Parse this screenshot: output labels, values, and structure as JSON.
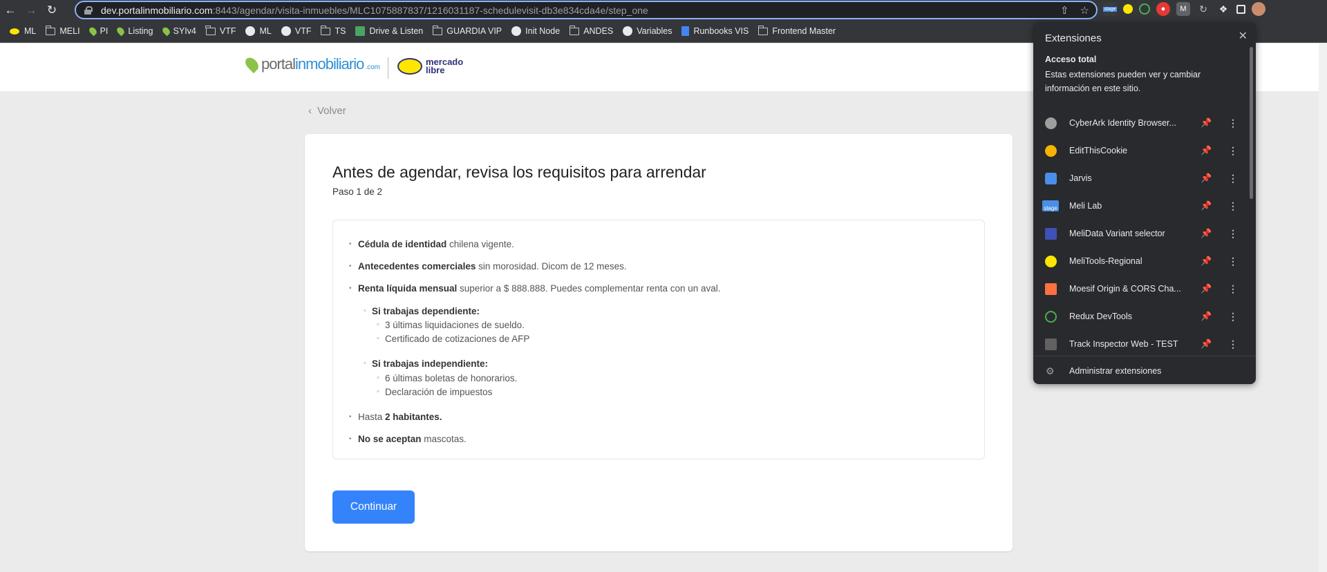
{
  "browser": {
    "url_host": "dev.portalinmobiliario.com",
    "url_path": ":8443/agendar/visita-inmuebles/MLC1075887837/1216031187-schedulevisit-db3e834cda4e/step_one",
    "bookmarks": [
      {
        "label": "ML",
        "icon": "meli-icon"
      },
      {
        "label": "MELI",
        "icon": "folder-icon"
      },
      {
        "label": "PI",
        "icon": "pin-icon"
      },
      {
        "label": "Listing",
        "icon": "pin-icon"
      },
      {
        "label": "SYIv4",
        "icon": "pin-icon"
      },
      {
        "label": "VTF",
        "icon": "folder-icon"
      },
      {
        "label": "ML",
        "icon": "github-icon"
      },
      {
        "label": "VTF",
        "icon": "cookie-icon"
      },
      {
        "label": "TS",
        "icon": "folder-icon"
      },
      {
        "label": "Drive & Listen",
        "icon": "drive-icon"
      },
      {
        "label": "GUARDIA VIP",
        "icon": "folder-icon"
      },
      {
        "label": "Init Node",
        "icon": "github-icon"
      },
      {
        "label": "ANDES",
        "icon": "folder-icon"
      },
      {
        "label": "Variables",
        "icon": "github-icon"
      },
      {
        "label": "Runbooks VIS",
        "icon": "doc-icon"
      },
      {
        "label": "Frontend Master",
        "icon": "folder-icon"
      }
    ]
  },
  "page": {
    "back": "Volver",
    "title": "Antes de agendar, revisa los requisitos para arrendar",
    "step": "Paso 1 de 2",
    "requirements": [
      {
        "strong": "Cédula de identidad",
        "text": " chilena vigente."
      },
      {
        "strong": "Antecedentes comerciales",
        "text": " sin morosidad. Dicom de 12 meses."
      },
      {
        "strong": "Renta líquida mensual",
        "text": " superior a $ 888.888. Puedes complementar renta con un aval."
      }
    ],
    "dependent": {
      "heading": "Si trabajas dependiente:",
      "items": [
        "3 últimas liquidaciones de sueldo.",
        "Certificado de cotizaciones de AFP"
      ]
    },
    "independent": {
      "heading": "Si trabajas independiente:",
      "items": [
        "6 últimas boletas de honorarios.",
        "Declaración de impuestos"
      ]
    },
    "inhabitants": {
      "text": "Hasta ",
      "strong": "2 habitantes."
    },
    "pets": {
      "strong": "No se aceptan",
      "text": " mascotas."
    },
    "continue": "Continuar"
  },
  "extensions": {
    "title": "Extensiones",
    "section": "Acceso total",
    "description": "Estas extensiones pueden ver y cambiar información en este sitio.",
    "items": [
      {
        "name": "CyberArk Identity Browser...",
        "pinned": false,
        "color": "#9e9e9e"
      },
      {
        "name": "EditThisCookie",
        "pinned": false,
        "color": "#f4b400"
      },
      {
        "name": "Jarvis",
        "pinned": false,
        "color": "#4a8fe7"
      },
      {
        "name": "Meli Lab",
        "pinned": true,
        "color": "#8bc34a"
      },
      {
        "name": "MeliData Variant selector",
        "pinned": false,
        "color": "#3f51b5"
      },
      {
        "name": "MeliTools-Regional",
        "pinned": false,
        "color": "#ffe600"
      },
      {
        "name": "Moesif Origin & CORS Cha...",
        "pinned": false,
        "color": "#ff7043"
      },
      {
        "name": "Redux DevTools",
        "pinned": true,
        "color": "#4caf50"
      },
      {
        "name": "Track Inspector Web - TEST",
        "pinned": false,
        "color": "#616161"
      }
    ],
    "manage": "Administrar extensiones",
    "stage_badge": "stage"
  }
}
